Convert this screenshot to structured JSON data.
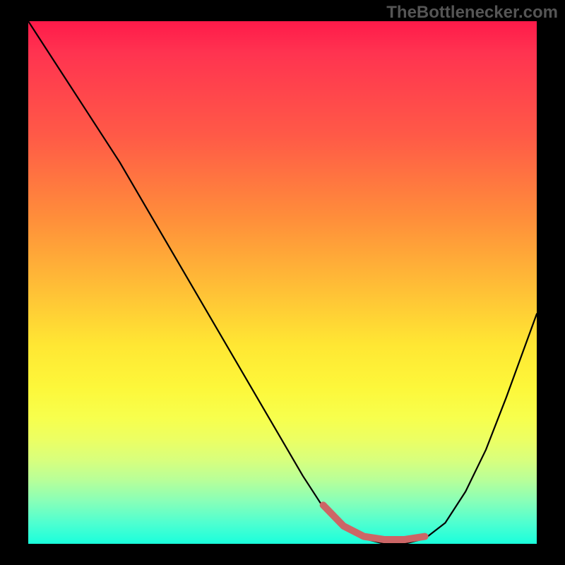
{
  "watermark": "TheBottlenecker.com",
  "chart_data": {
    "type": "line",
    "title": "",
    "xlabel": "",
    "ylabel": "",
    "xlim": [
      0,
      100
    ],
    "ylim": [
      0,
      100
    ],
    "x": [
      0,
      6,
      12,
      18,
      24,
      30,
      36,
      42,
      48,
      54,
      58,
      62,
      66,
      70,
      74,
      78,
      82,
      86,
      90,
      94,
      100
    ],
    "values": [
      100,
      91,
      82,
      73,
      63,
      53,
      43,
      33,
      23,
      13,
      7,
      3,
      1,
      0,
      0,
      1,
      4,
      10,
      18,
      28,
      44
    ],
    "highlight_range_x": [
      58,
      78
    ],
    "background_gradient": {
      "top_color": "#ff1a4a",
      "bottom_color": "#1affdc"
    }
  }
}
